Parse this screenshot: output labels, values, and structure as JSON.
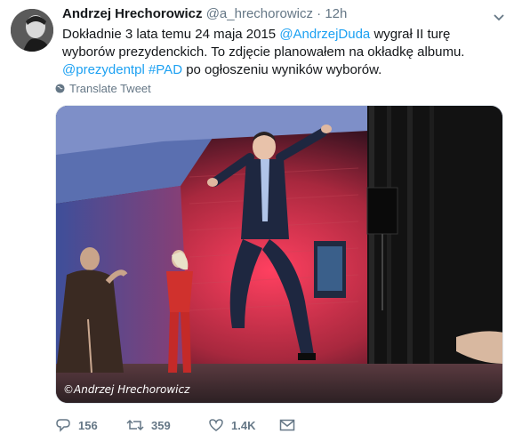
{
  "tweet": {
    "author_name": "Andrzej Hrechorowicz",
    "author_handle": "@a_hrechorowicz",
    "separator": "·",
    "time": "12h",
    "text_part1": "Dokładnie 3 lata temu 24 maja 2015 ",
    "mention1": "@AndrzejDuda",
    "text_part2": " wygrał II turę wyborów prezydenckich. To zdjęcie planowałem na okładkę albumu. ",
    "mention2": "@prezydentpl",
    "hashtag": "#PAD",
    "text_part3": " po ogłoszeniu wyników wyborów.",
    "translate_label": "Translate Tweet",
    "photo_caption": "©Andrzej Hrechorowicz"
  },
  "actions": {
    "reply_count": "156",
    "retweet_count": "359",
    "like_count": "1.4K"
  },
  "icons": {
    "reply": "reply-icon",
    "retweet": "retweet-icon",
    "like": "heart-icon",
    "dm": "mail-icon",
    "more": "chevron-down-icon",
    "globe": "globe-icon"
  },
  "colors": {
    "link": "#1da1f2",
    "muted": "#657786",
    "text": "#14171a"
  }
}
